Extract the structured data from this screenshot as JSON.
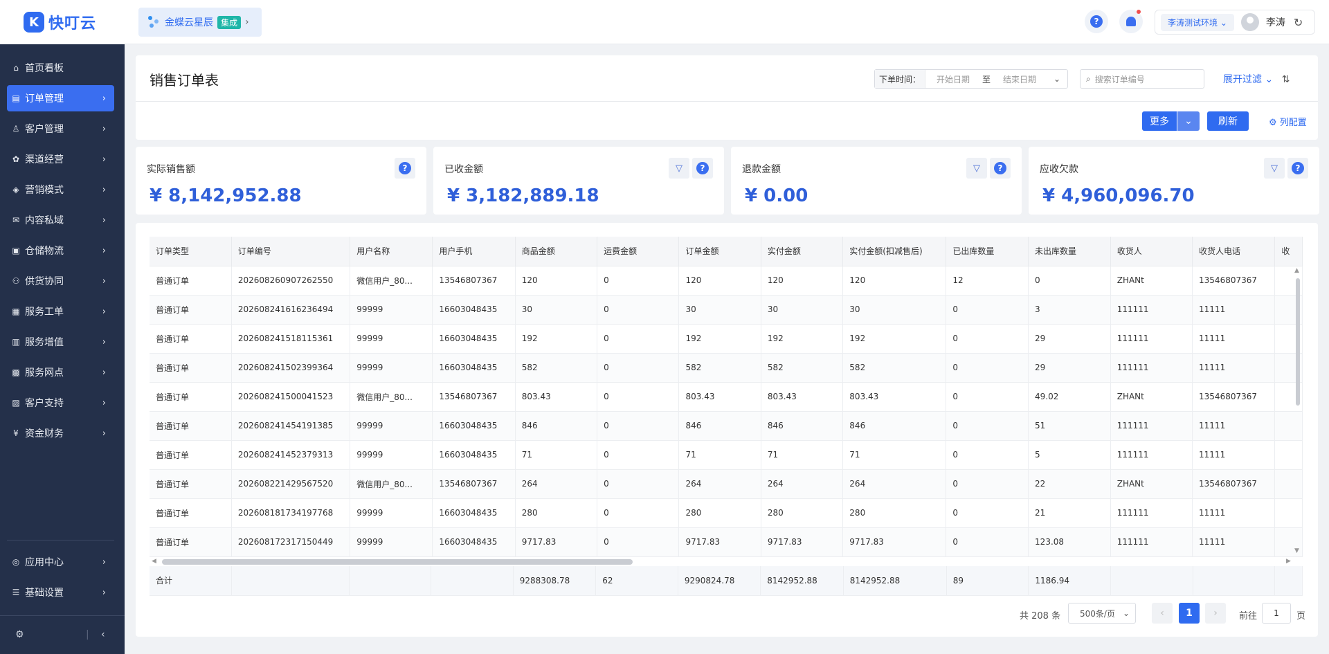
{
  "header": {
    "logo_mark": "K",
    "logo_text": "快叮云",
    "integration_name": "金蝶云星辰",
    "integration_badge": "集成",
    "help_icon_text": "?",
    "environment": "李涛测试环境",
    "user_name": "李涛"
  },
  "sidebar": {
    "items": [
      {
        "label": "首页看板",
        "icon": "home-icon",
        "glyph": "⌂",
        "active": false,
        "chevron": false
      },
      {
        "label": "订单管理",
        "icon": "order-icon",
        "glyph": "▤",
        "active": true,
        "chevron": true
      },
      {
        "label": "客户管理",
        "icon": "user-icon",
        "glyph": "♙",
        "active": false,
        "chevron": true
      },
      {
        "label": "渠道经营",
        "icon": "channel-icon",
        "glyph": "✿",
        "active": false,
        "chevron": true
      },
      {
        "label": "营销模式",
        "icon": "tag-icon",
        "glyph": "◈",
        "active": false,
        "chevron": true
      },
      {
        "label": "内容私域",
        "icon": "mail-icon",
        "glyph": "✉",
        "active": false,
        "chevron": true
      },
      {
        "label": "仓储物流",
        "icon": "warehouse-icon",
        "glyph": "▣",
        "active": false,
        "chevron": true
      },
      {
        "label": "供货协同",
        "icon": "supply-icon",
        "glyph": "⚇",
        "active": false,
        "chevron": true
      },
      {
        "label": "服务工单",
        "icon": "ticket-icon",
        "glyph": "▦",
        "active": false,
        "chevron": true
      },
      {
        "label": "服务增值",
        "icon": "bag-icon",
        "glyph": "▥",
        "active": false,
        "chevron": true
      },
      {
        "label": "服务网点",
        "icon": "store-icon",
        "glyph": "▩",
        "active": false,
        "chevron": true
      },
      {
        "label": "客户支持",
        "icon": "support-icon",
        "glyph": "▨",
        "active": false,
        "chevron": true
      },
      {
        "label": "资金财务",
        "icon": "yen-icon",
        "glyph": "¥",
        "active": false,
        "chevron": true
      }
    ],
    "bottom_items": [
      {
        "label": "应用中心",
        "icon": "app-center-icon",
        "glyph": "◎"
      },
      {
        "label": "基础设置",
        "icon": "settings-list-icon",
        "glyph": "☰"
      }
    ]
  },
  "page": {
    "title": "销售订单表",
    "date_label": "下单时间：",
    "start_placeholder": "开始日期",
    "date_sep": "至",
    "end_placeholder": "结束日期",
    "search_placeholder": "搜索订单编号",
    "expand_filter": "展开过滤",
    "more_button": "更多",
    "refresh_button": "刷新",
    "column_config": "列配置"
  },
  "stats": [
    {
      "label": "实际销售额",
      "value": "¥ 8,142,952.88",
      "has_filter": false
    },
    {
      "label": "已收金额",
      "value": "¥ 3,182,889.18",
      "has_filter": true
    },
    {
      "label": "退款金额",
      "value": "¥ 0.00",
      "has_filter": true
    },
    {
      "label": "应收欠款",
      "value": "¥ 4,960,096.70",
      "has_filter": true
    }
  ],
  "table": {
    "columns": [
      "订单类型",
      "订单编号",
      "用户名称",
      "用户手机",
      "商品金额",
      "运费金额",
      "订单金额",
      "实付金额",
      "实付金额(扣减售后)",
      "已出库数量",
      "未出库数量",
      "收货人",
      "收货人电话",
      "收"
    ],
    "rows": [
      [
        "普通订单",
        "202608260907262550",
        "微信用户_80...",
        "13546807367",
        "120",
        "0",
        "120",
        "120",
        "120",
        "12",
        "0",
        "ZHANt",
        "13546807367"
      ],
      [
        "普通订单",
        "202608241616236494",
        "99999",
        "16603048435",
        "30",
        "0",
        "30",
        "30",
        "30",
        "0",
        "3",
        "111111",
        "11111"
      ],
      [
        "普通订单",
        "202608241518115361",
        "99999",
        "16603048435",
        "192",
        "0",
        "192",
        "192",
        "192",
        "0",
        "29",
        "111111",
        "11111"
      ],
      [
        "普通订单",
        "202608241502399364",
        "99999",
        "16603048435",
        "582",
        "0",
        "582",
        "582",
        "582",
        "0",
        "29",
        "111111",
        "11111"
      ],
      [
        "普通订单",
        "202608241500041523",
        "微信用户_80...",
        "13546807367",
        "803.43",
        "0",
        "803.43",
        "803.43",
        "803.43",
        "0",
        "49.02",
        "ZHANt",
        "13546807367"
      ],
      [
        "普通订单",
        "202608241454191385",
        "99999",
        "16603048435",
        "846",
        "0",
        "846",
        "846",
        "846",
        "0",
        "51",
        "111111",
        "11111"
      ],
      [
        "普通订单",
        "202608241452379313",
        "99999",
        "16603048435",
        "71",
        "0",
        "71",
        "71",
        "71",
        "0",
        "5",
        "111111",
        "11111"
      ],
      [
        "普通订单",
        "202608221429567520",
        "微信用户_80...",
        "13546807367",
        "264",
        "0",
        "264",
        "264",
        "264",
        "0",
        "22",
        "ZHANt",
        "13546807367"
      ],
      [
        "普通订单",
        "202608181734197768",
        "99999",
        "16603048435",
        "280",
        "0",
        "280",
        "280",
        "280",
        "0",
        "21",
        "111111",
        "11111"
      ],
      [
        "普通订单",
        "202608172317150449",
        "99999",
        "16603048435",
        "9717.83",
        "0",
        "9717.83",
        "9717.83",
        "9717.83",
        "0",
        "123.08",
        "111111",
        "11111"
      ]
    ],
    "summary": [
      "合计",
      "",
      "",
      "",
      "9288308.78",
      "62",
      "9290824.78",
      "8142952.88",
      "8142952.88",
      "89",
      "1186.94",
      "",
      ""
    ]
  },
  "pagination": {
    "total_text": "共 208 条",
    "page_size": "500条/页",
    "current_page": "1",
    "goto_label": "前往",
    "goto_value": "1",
    "page_suffix": "页"
  }
}
